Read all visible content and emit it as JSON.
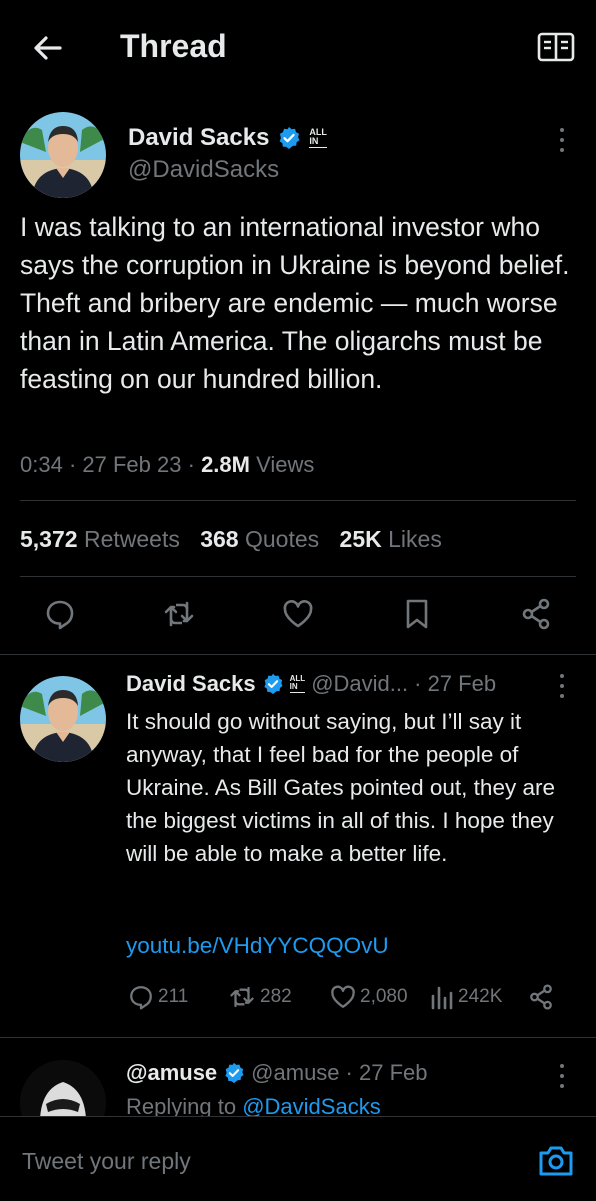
{
  "header": {
    "title": "Thread",
    "back_icon": "arrow-left-icon",
    "reader_icon": "reader-mode-icon"
  },
  "main_tweet": {
    "author_name": "David Sacks",
    "author_handle": "@DavidSacks",
    "affiliate_badge": [
      "ALL",
      "IN"
    ],
    "text": "I was talking to an international investor who says the corruption in Ukraine is beyond belief. Theft and bribery are endemic — much worse than in Latin America. The oligarchs must be feasting on our hundred billion.",
    "time": "0:34",
    "date": "27 Feb 23",
    "views_count": "2.8M",
    "views_label": "Views",
    "retweets_count": "5,372",
    "retweets_label": "Retweets",
    "quotes_count": "368",
    "quotes_label": "Quotes",
    "likes_count": "25K",
    "likes_label": "Likes"
  },
  "reply_tweet": {
    "author_name": "David Sacks",
    "author_handle": "@David...",
    "date": "· 27 Feb",
    "text": "It should go without saying, but I’ll say it anyway, that I feel bad for the people of Ukraine. As Bill Gates pointed out, they are the biggest victims in all of this. I hope they will be able to make a better life.",
    "link": "youtu.be/VHdYYCQQOvU",
    "replies": "211",
    "retweets": "282",
    "likes": "2,080",
    "views": "242K"
  },
  "third_tweet": {
    "author_name": "@amuse",
    "author_handle": "@amuse",
    "date": "· 27 Feb",
    "replying_prefix": "Replying to",
    "replying_to": "@DavidSacks"
  },
  "composer": {
    "placeholder": "Tweet your reply",
    "camera_icon": "camera-icon"
  },
  "colors": {
    "background": "#000000",
    "text": "#e7e9ea",
    "muted": "#71767b",
    "accent": "#1d9bf0",
    "divider": "#2f3336"
  }
}
